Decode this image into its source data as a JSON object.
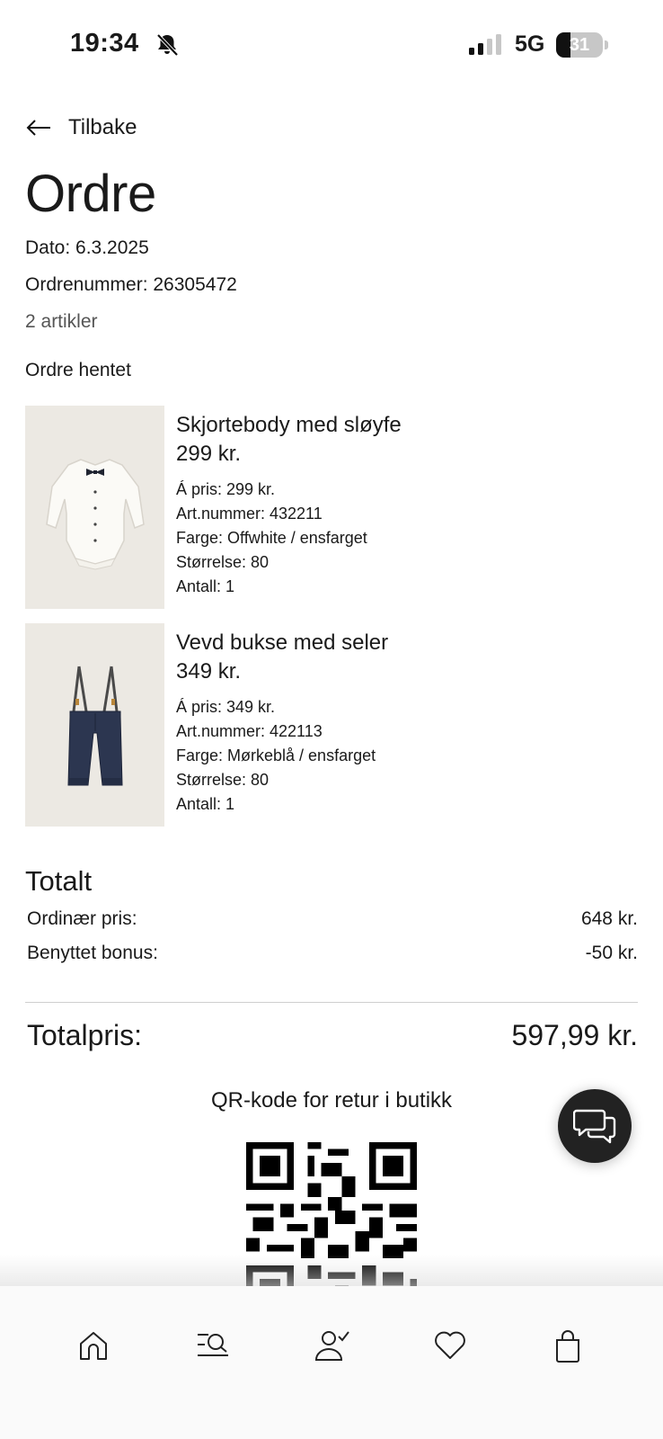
{
  "status_bar": {
    "time": "19:34",
    "network": "5G",
    "battery_level": "31",
    "battery_fraction": 0.31
  },
  "header": {
    "back_label": "Tilbake",
    "title": "Ordre"
  },
  "order": {
    "date": "Dato: 6.3.2025",
    "number": "Ordrenummer: 26305472",
    "item_count": "2 artikler",
    "status": "Ordre hentet"
  },
  "items": [
    {
      "name": "Skjortebody med sløyfe",
      "price": "299 kr.",
      "unit_price": "Á pris: 299 kr.",
      "article_number": "Art.nummer: 432211",
      "color": "Farge: Offwhite / ensfarget",
      "size": "Størrelse: 80",
      "quantity": "Antall: 1",
      "image_icon": "shirt-bodysuit"
    },
    {
      "name": "Vevd bukse med seler",
      "price": "349 kr.",
      "unit_price": "Á pris: 349 kr.",
      "article_number": "Art.nummer: 422113",
      "color": "Farge: Mørkeblå / ensfarget",
      "size": "Størrelse: 80",
      "quantity": "Antall: 1",
      "image_icon": "trousers-with-suspenders"
    }
  ],
  "totals": {
    "title": "Totalt",
    "regular_label": "Ordinær pris:",
    "regular_value": "648 kr.",
    "bonus_label": "Benyttet bonus:",
    "bonus_value": "-50 kr.",
    "grand_label": "Totalpris:",
    "grand_value": "597,99 kr."
  },
  "qr": {
    "label": "QR-kode for retur i butikk"
  },
  "bottom_nav": [
    {
      "icon": "home-icon"
    },
    {
      "icon": "search-icon"
    },
    {
      "icon": "account-icon"
    },
    {
      "icon": "heart-icon"
    },
    {
      "icon": "bag-icon"
    }
  ],
  "colors": {
    "text": "#1a1a1a",
    "muted": "#555555",
    "product_bg": "#ece9e3",
    "chat_button": "#222222",
    "trousers": "#2c3650"
  }
}
